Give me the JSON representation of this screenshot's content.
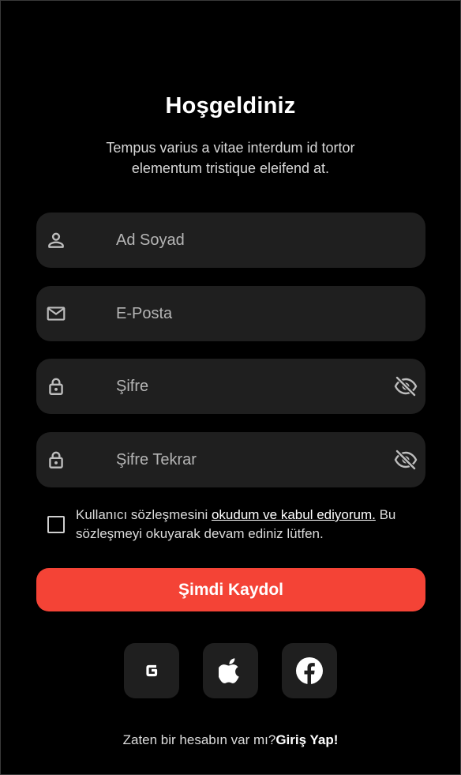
{
  "header": {
    "title": "Hoşgeldiniz",
    "subtitle": "Tempus varius a vitae interdum id tortor elementum tristique eleifend at."
  },
  "form": {
    "name_placeholder": "Ad Soyad",
    "email_placeholder": "E-Posta",
    "password_placeholder": "Şifre",
    "password_repeat_placeholder": "Şifre Tekrar"
  },
  "agreement": {
    "prefix": "Kullanıcı sözleşmesini ",
    "link": "okudum ve kabul ediyorum.",
    "suffix": " Bu sözleşmeyi okuyarak devam ediniz lütfen.",
    "checked": false
  },
  "actions": {
    "register_label": "Şimdi Kaydol"
  },
  "social": [
    {
      "icon": "google-icon"
    },
    {
      "icon": "apple-icon"
    },
    {
      "icon": "facebook-icon"
    }
  ],
  "footer": {
    "prompt": "Zaten bir hesabın var mı?",
    "login_link": "Giriş Yap!"
  },
  "colors": {
    "background": "#000000",
    "field": "#1f1f1f",
    "accent": "#f44336",
    "text": "#ffffff"
  }
}
